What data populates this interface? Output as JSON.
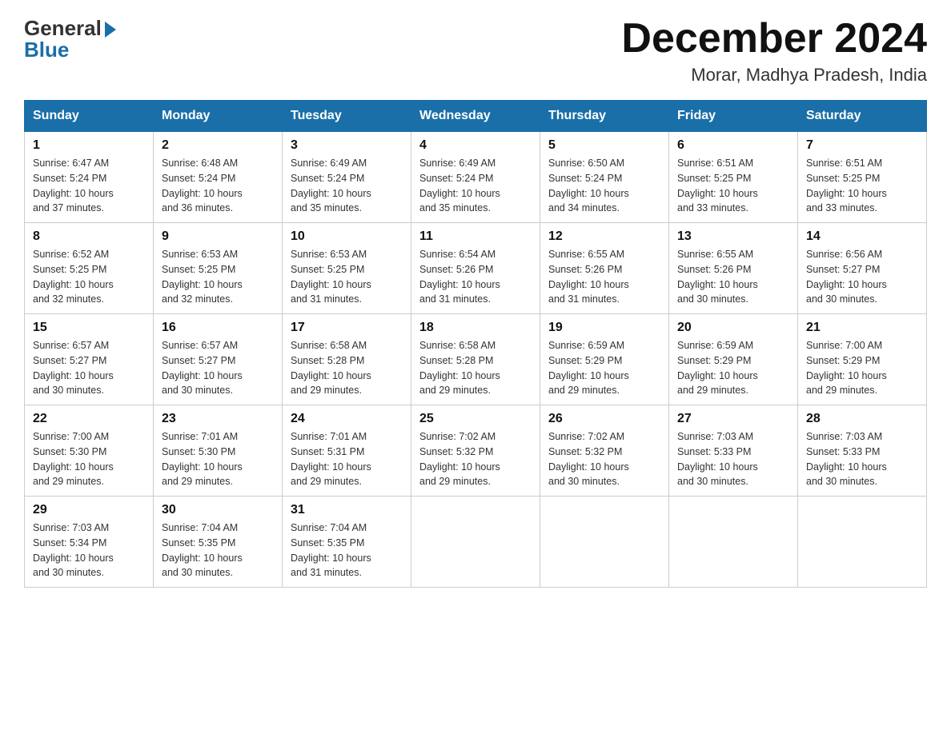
{
  "logo": {
    "general": "General",
    "blue": "Blue"
  },
  "title": "December 2024",
  "subtitle": "Morar, Madhya Pradesh, India",
  "weekdays": [
    "Sunday",
    "Monday",
    "Tuesday",
    "Wednesday",
    "Thursday",
    "Friday",
    "Saturday"
  ],
  "weeks": [
    [
      {
        "day": "1",
        "sunrise": "6:47 AM",
        "sunset": "5:24 PM",
        "daylight": "10 hours and 37 minutes."
      },
      {
        "day": "2",
        "sunrise": "6:48 AM",
        "sunset": "5:24 PM",
        "daylight": "10 hours and 36 minutes."
      },
      {
        "day": "3",
        "sunrise": "6:49 AM",
        "sunset": "5:24 PM",
        "daylight": "10 hours and 35 minutes."
      },
      {
        "day": "4",
        "sunrise": "6:49 AM",
        "sunset": "5:24 PM",
        "daylight": "10 hours and 35 minutes."
      },
      {
        "day": "5",
        "sunrise": "6:50 AM",
        "sunset": "5:24 PM",
        "daylight": "10 hours and 34 minutes."
      },
      {
        "day": "6",
        "sunrise": "6:51 AM",
        "sunset": "5:25 PM",
        "daylight": "10 hours and 33 minutes."
      },
      {
        "day": "7",
        "sunrise": "6:51 AM",
        "sunset": "5:25 PM",
        "daylight": "10 hours and 33 minutes."
      }
    ],
    [
      {
        "day": "8",
        "sunrise": "6:52 AM",
        "sunset": "5:25 PM",
        "daylight": "10 hours and 32 minutes."
      },
      {
        "day": "9",
        "sunrise": "6:53 AM",
        "sunset": "5:25 PM",
        "daylight": "10 hours and 32 minutes."
      },
      {
        "day": "10",
        "sunrise": "6:53 AM",
        "sunset": "5:25 PM",
        "daylight": "10 hours and 31 minutes."
      },
      {
        "day": "11",
        "sunrise": "6:54 AM",
        "sunset": "5:26 PM",
        "daylight": "10 hours and 31 minutes."
      },
      {
        "day": "12",
        "sunrise": "6:55 AM",
        "sunset": "5:26 PM",
        "daylight": "10 hours and 31 minutes."
      },
      {
        "day": "13",
        "sunrise": "6:55 AM",
        "sunset": "5:26 PM",
        "daylight": "10 hours and 30 minutes."
      },
      {
        "day": "14",
        "sunrise": "6:56 AM",
        "sunset": "5:27 PM",
        "daylight": "10 hours and 30 minutes."
      }
    ],
    [
      {
        "day": "15",
        "sunrise": "6:57 AM",
        "sunset": "5:27 PM",
        "daylight": "10 hours and 30 minutes."
      },
      {
        "day": "16",
        "sunrise": "6:57 AM",
        "sunset": "5:27 PM",
        "daylight": "10 hours and 30 minutes."
      },
      {
        "day": "17",
        "sunrise": "6:58 AM",
        "sunset": "5:28 PM",
        "daylight": "10 hours and 29 minutes."
      },
      {
        "day": "18",
        "sunrise": "6:58 AM",
        "sunset": "5:28 PM",
        "daylight": "10 hours and 29 minutes."
      },
      {
        "day": "19",
        "sunrise": "6:59 AM",
        "sunset": "5:29 PM",
        "daylight": "10 hours and 29 minutes."
      },
      {
        "day": "20",
        "sunrise": "6:59 AM",
        "sunset": "5:29 PM",
        "daylight": "10 hours and 29 minutes."
      },
      {
        "day": "21",
        "sunrise": "7:00 AM",
        "sunset": "5:29 PM",
        "daylight": "10 hours and 29 minutes."
      }
    ],
    [
      {
        "day": "22",
        "sunrise": "7:00 AM",
        "sunset": "5:30 PM",
        "daylight": "10 hours and 29 minutes."
      },
      {
        "day": "23",
        "sunrise": "7:01 AM",
        "sunset": "5:30 PM",
        "daylight": "10 hours and 29 minutes."
      },
      {
        "day": "24",
        "sunrise": "7:01 AM",
        "sunset": "5:31 PM",
        "daylight": "10 hours and 29 minutes."
      },
      {
        "day": "25",
        "sunrise": "7:02 AM",
        "sunset": "5:32 PM",
        "daylight": "10 hours and 29 minutes."
      },
      {
        "day": "26",
        "sunrise": "7:02 AM",
        "sunset": "5:32 PM",
        "daylight": "10 hours and 30 minutes."
      },
      {
        "day": "27",
        "sunrise": "7:03 AM",
        "sunset": "5:33 PM",
        "daylight": "10 hours and 30 minutes."
      },
      {
        "day": "28",
        "sunrise": "7:03 AM",
        "sunset": "5:33 PM",
        "daylight": "10 hours and 30 minutes."
      }
    ],
    [
      {
        "day": "29",
        "sunrise": "7:03 AM",
        "sunset": "5:34 PM",
        "daylight": "10 hours and 30 minutes."
      },
      {
        "day": "30",
        "sunrise": "7:04 AM",
        "sunset": "5:35 PM",
        "daylight": "10 hours and 30 minutes."
      },
      {
        "day": "31",
        "sunrise": "7:04 AM",
        "sunset": "5:35 PM",
        "daylight": "10 hours and 31 minutes."
      },
      null,
      null,
      null,
      null
    ]
  ],
  "labels": {
    "sunrise": "Sunrise:",
    "sunset": "Sunset:",
    "daylight": "Daylight:"
  }
}
